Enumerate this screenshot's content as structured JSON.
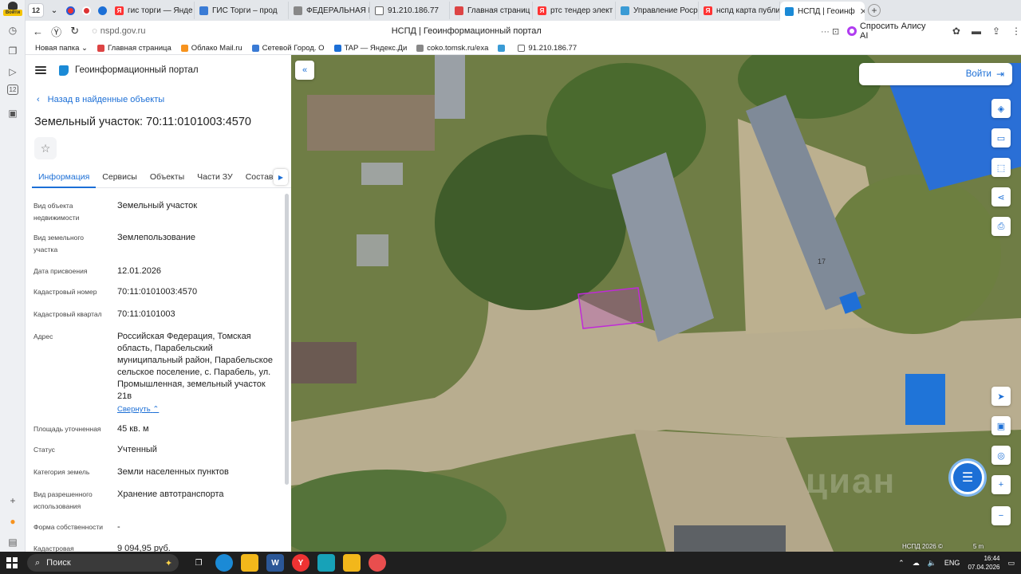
{
  "browser": {
    "tab_count": "12",
    "tabs": [
      {
        "label": "гис торги — Янде",
        "color": "#f33"
      },
      {
        "label": "ГИС Торги – прод",
        "color": "#3a7bd5"
      },
      {
        "label": "ФЕДЕРАЛЬНАЯ И",
        "color": "#888"
      },
      {
        "label": "91.210.186.77",
        "color": "#666"
      },
      {
        "label": "Главная страниц",
        "color": "#d44"
      },
      {
        "label": "ртс тендер элект",
        "color": "#f33"
      },
      {
        "label": "Управление Роср",
        "color": "#3a9bd5"
      },
      {
        "label": "нспд карта публи",
        "color": "#f33"
      },
      {
        "label": "НСПД | Геоинф",
        "color": "#1b8ad6"
      }
    ],
    "url_host": "nspd.gov.ru",
    "page_title": "НСПД | Геоинформационный портал",
    "url_actions": "··· ⊡",
    "alisa_label": "Спросить Алису AI",
    "bookmarks": [
      {
        "label": "Новая папка ⌄",
        "color": ""
      },
      {
        "label": "Главная страница",
        "color": "#d44"
      },
      {
        "label": "Облако Mail.ru",
        "color": "#f7931e"
      },
      {
        "label": "Сетевой Город. О",
        "color": "#3a7bd5"
      },
      {
        "label": "TAP — Яндекс.Ди",
        "color": "#1c6fd6"
      },
      {
        "label": "coko.tomsk.ru/exa",
        "color": "#888"
      },
      {
        "label": "",
        "color": "#3a9bd5"
      },
      {
        "label": "91.210.186.77",
        "color": "#666"
      }
    ],
    "side_badge": "Войти",
    "side_badge_num": "12"
  },
  "portal": {
    "name": "Геоинформационный портал",
    "back_label": "Назад в найденные объекты",
    "object_title": "Земельный участок: 70:11:0101003:4570",
    "tabs": [
      "Информация",
      "Сервисы",
      "Объекты",
      "Части ЗУ",
      "Состав"
    ],
    "collapse_label": "Свернуть",
    "properties": [
      {
        "label": "Вид объекта недвижимости",
        "value": "Земельный участок"
      },
      {
        "label": "Вид земельного участка",
        "value": "Землепользование"
      },
      {
        "label": "Дата присвоения",
        "value": "12.01.2026"
      },
      {
        "label": "Кадастровый номер",
        "value": "70:11:0101003:4570"
      },
      {
        "label": "Кадастровый квартал",
        "value": "70:11:0101003"
      },
      {
        "label": "Адрес",
        "value": "Российская Федерация, Томская область, Парабельский муниципальный район, Парабельское сельское поселение, с. Парабель, ул. Промышленная, земельный участок 21в"
      },
      {
        "label": "Площадь уточненная",
        "value": "45 кв. м"
      },
      {
        "label": "Статус",
        "value": "Учтенный"
      },
      {
        "label": "Категория земель",
        "value": "Земли населенных пунктов"
      },
      {
        "label": "Вид разрешенного использования",
        "value": "Хранение автотранспорта"
      },
      {
        "label": "Форма собственности",
        "value": "-"
      },
      {
        "label": "Кадастровая",
        "value": "9 094,95 руб."
      }
    ]
  },
  "map": {
    "login_label": "Войти",
    "attribution": "НСПД 2026 ©",
    "scale_label": "5 m",
    "watermark": "циан",
    "building_number": "17",
    "parcel_color": "#c02ad8"
  },
  "taskbar": {
    "search_label": "Поиск",
    "lang": "ENG",
    "time": "16:44",
    "date": "07.04.2026"
  }
}
